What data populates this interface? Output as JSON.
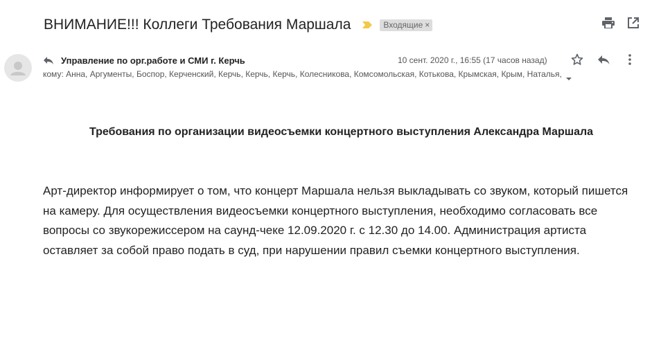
{
  "email": {
    "subject": "ВНИМАНИЕ!!! Коллеги Требования Маршала",
    "label": "Входящие",
    "label_close": "×",
    "sender": "Управление по орг.работе и СМИ г. Керчь",
    "date": "10 сент. 2020 г., 16:55 (17 часов назад)",
    "recipients": "кому: Анна, Аргументы, Боспор, Керченский, Керчь, Керчь, Керчь, Колесникова, Комсомольская, Котькова, Крымская, Крым, Наталья,",
    "body_title": "Требования по организации видеосъемки концертного выступления Александра Маршала",
    "body_text": "Арт-директор информирует о том, что концерт Маршала нельзя выкладывать со звуком, который пишется на камеру. Для осуществления видеосъемки концертного выступления, необходимо согласовать все вопросы со звукорежиссером на саунд-чеке 12.09.2020 г. с 12.30 до 14.00. Администрация артиста оставляет за собой право подать в суд, при нарушении правил съемки концертного выступления."
  },
  "icons": {
    "importance": "importance-marker-icon",
    "print": "print-icon",
    "open_new_window": "open-in-new-window-icon",
    "sender_reply": "reply-indicator-icon",
    "star": "star-icon",
    "reply": "reply-icon",
    "more": "more-vert-icon",
    "caret": "caret-down-icon",
    "avatar": "avatar-icon"
  },
  "colors": {
    "importance": "#f2c94c",
    "text": "#222222",
    "secondary_text": "#555555",
    "icon": "#5f6368"
  }
}
